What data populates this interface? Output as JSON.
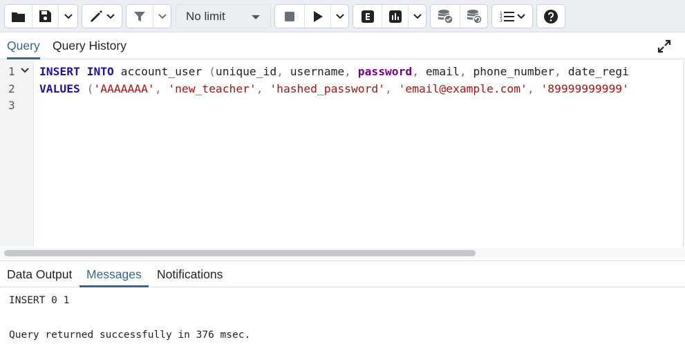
{
  "toolbar": {
    "buttons": [
      {
        "icon": "folder-open-icon"
      },
      {
        "icon": "save-icon"
      },
      {
        "icon": "chevron-down-icon"
      },
      {
        "icon": "edit-pen-icon"
      },
      {
        "icon": "filter-icon"
      },
      {
        "icon": "stop-icon"
      },
      {
        "icon": "play-icon"
      },
      {
        "icon": "explain-icon"
      },
      {
        "icon": "explain-analyze-icon"
      },
      {
        "icon": "commit-icon"
      },
      {
        "icon": "rollback-icon"
      },
      {
        "icon": "macros-icon"
      },
      {
        "icon": "help-icon"
      }
    ],
    "limit_value": "No limit"
  },
  "query_tabs": [
    "Query",
    "Query History"
  ],
  "active_query_tab": "Query",
  "editor": {
    "line_numbers": [
      "1",
      "2",
      "3"
    ],
    "lines": [
      [
        {
          "t": "INSERT",
          "c": "kw"
        },
        {
          "t": " ",
          "c": "plain"
        },
        {
          "t": "INTO",
          "c": "kw"
        },
        {
          "t": " account_user ",
          "c": "plain"
        },
        {
          "t": "(",
          "c": "punc"
        },
        {
          "t": "unique_id",
          "c": "plain"
        },
        {
          "t": ", ",
          "c": "punc"
        },
        {
          "t": "username",
          "c": "plain"
        },
        {
          "t": ", ",
          "c": "punc"
        },
        {
          "t": "password",
          "c": "kw2"
        },
        {
          "t": ", ",
          "c": "punc"
        },
        {
          "t": "email",
          "c": "plain"
        },
        {
          "t": ", ",
          "c": "punc"
        },
        {
          "t": "phone_number",
          "c": "plain"
        },
        {
          "t": ", ",
          "c": "punc"
        },
        {
          "t": "date_regi",
          "c": "plain"
        }
      ],
      [
        {
          "t": "VALUES",
          "c": "kw"
        },
        {
          "t": " ",
          "c": "plain"
        },
        {
          "t": "(",
          "c": "punc"
        },
        {
          "t": "'AAAAAAA'",
          "c": "str"
        },
        {
          "t": ", ",
          "c": "punc"
        },
        {
          "t": "'new_teacher'",
          "c": "str"
        },
        {
          "t": ", ",
          "c": "punc"
        },
        {
          "t": "'hashed_password'",
          "c": "str"
        },
        {
          "t": ", ",
          "c": "punc"
        },
        {
          "t": "'email@example.com'",
          "c": "str"
        },
        {
          "t": ", ",
          "c": "punc"
        },
        {
          "t": "'89999999999'",
          "c": "str"
        }
      ],
      []
    ]
  },
  "result_tabs": [
    "Data Output",
    "Messages",
    "Notifications"
  ],
  "active_result_tab": "Messages",
  "messages": {
    "line1": "INSERT 0 1",
    "line2": "Query returned successfully in 376 msec."
  },
  "colors": {
    "accent": "#326690",
    "keyword": "#221199",
    "builtin": "#770088",
    "string": "#aa1111"
  }
}
